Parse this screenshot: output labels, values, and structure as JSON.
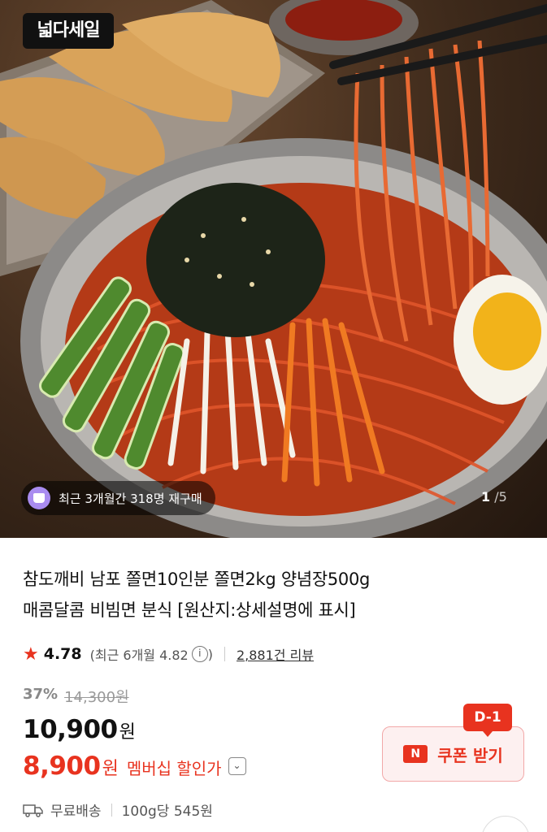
{
  "hero": {
    "logo_text": "넓다세일",
    "rebuy_text": "최근 3개월간 318명 재구매",
    "image_index": "1",
    "image_total": "/5"
  },
  "product": {
    "title_line1": "참도깨비 남포 쫄면10인분 쫄면2kg 양념장500g",
    "title_line2": "매콤달콤 비빔면 분식 [원산지:상세설명에 표시]"
  },
  "rating": {
    "score": "4.78",
    "recent": "(최근 6개월 4.82",
    "info_icon": "i",
    "close_paren": ")",
    "reviews": "2,881건 리뷰"
  },
  "pricing": {
    "discount_pct": "37%",
    "original_price": "14,300원",
    "price": "10,900",
    "price_unit": "원",
    "member_price": "8,900",
    "member_unit": "원",
    "member_label": "멤버십 할인가"
  },
  "coupon": {
    "dday": "D-1",
    "logo": "N",
    "label": "쿠폰 받기"
  },
  "shipping": {
    "free": "무료배송",
    "unit_price": "100g당 545원"
  },
  "colors": {
    "accent_red": "#e8331f",
    "rebuy_icon": "#a98cf0"
  }
}
